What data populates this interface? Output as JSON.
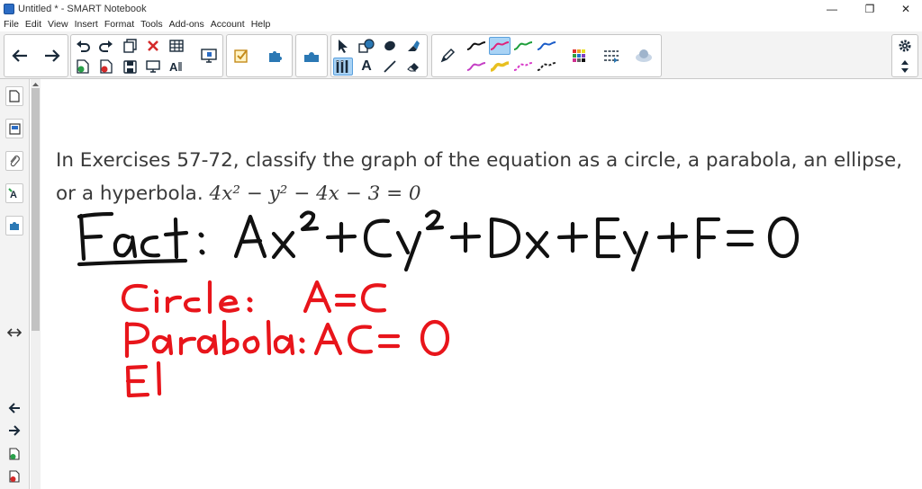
{
  "window": {
    "title": "Untitled * - SMART Notebook",
    "minimize_glyph": "—",
    "restore_glyph": "❐",
    "close_glyph": "✕"
  },
  "menu": [
    "File",
    "Edit",
    "View",
    "Insert",
    "Format",
    "Tools",
    "Add-ons",
    "Account",
    "Help"
  ],
  "toolbar": {
    "icons": [
      "back-arrow-icon",
      "forward-arrow-icon",
      "undo-icon",
      "redo-icon",
      "new-page-icon",
      "delete-icon",
      "table-icon",
      "screen-shade-icon",
      "add-page-icon",
      "clear-page-icon",
      "save-icon",
      "full-screen-icon",
      "text-format-icon",
      "document-camera-icon",
      "activity-check-icon",
      "add-ons-icon",
      "ink-shape-icon",
      "select-icon",
      "shapes-icon",
      "fill-icon",
      "eraser-icon",
      "pens-icon",
      "text-icon",
      "lines-icon",
      "pen-icon",
      "color-grid-icon",
      "line-style-icon",
      "properties-icon",
      "settings-icon",
      "move-toolbar-icon"
    ],
    "text_tool_glyph": "A",
    "pen_colors": [
      "#111111",
      "#e0217a",
      "#1e9e3a",
      "#1a5cc8",
      "#c43ec4",
      "#e8c020",
      "#d838c8",
      "#222222"
    ],
    "selected_pen_color": "#e0217a"
  },
  "sidebar": {
    "icons": [
      "page-sorter-icon",
      "gallery-icon",
      "attachments-icon",
      "properties-icon",
      "add-ons-icon",
      "resize-arrows-icon",
      "back-arrow-icon",
      "forward-arrow-icon",
      "add-page-icon",
      "delete-page-icon"
    ]
  },
  "page": {
    "problem_text": "In Exercises 57-72, classify the graph of the equation as a circle, a parabola, an ellipse, or a hyperbola. ",
    "equation": "4x² − y² − 4x − 3 = 0",
    "ink_colors": {
      "black": "#111111",
      "red": "#e8151b"
    },
    "handwriting": {
      "fact_label": "Fact:",
      "general_form": "Ax² + Cy² + Dx + Ey + F = 0",
      "circle_rule": "Circle: A = C",
      "parabola_rule": "Parabola: AC = 0",
      "ellipse_partial": "El"
    }
  }
}
